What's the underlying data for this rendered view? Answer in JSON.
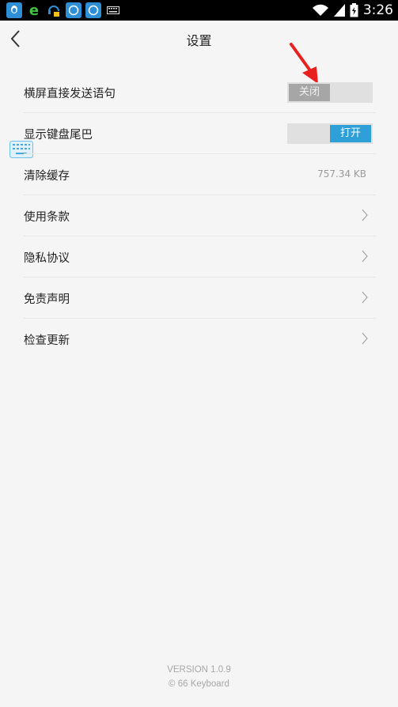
{
  "status_bar": {
    "time": "3:26",
    "icons": [
      "qq-icon",
      "ie-browser-icon",
      "headset-lock-icon",
      "app-badge-icon",
      "app-badge-icon",
      "keyboard-icon",
      "wifi-icon",
      "signal-icon",
      "battery-icon"
    ]
  },
  "header": {
    "title": "设置"
  },
  "settings": {
    "rows": [
      {
        "label": "横屏直接发送语句",
        "toggle": "关闭",
        "state": "off"
      },
      {
        "label": "显示键盘尾巴",
        "toggle": "打开",
        "state": "on"
      },
      {
        "label": "清除缓存",
        "value": "757.34 KB"
      },
      {
        "label": "使用条款"
      },
      {
        "label": "隐私协议"
      },
      {
        "label": "免责声明"
      },
      {
        "label": "检查更新"
      }
    ]
  },
  "footer": {
    "version": "VERSION 1.0.9",
    "copyright": "© 66 Keyboard"
  },
  "colors": {
    "accent": "#2f9fd8",
    "toggle_off": "#a6a6a6",
    "toggle_track": "#e0e0e0",
    "annotation_arrow": "#e8201e"
  }
}
